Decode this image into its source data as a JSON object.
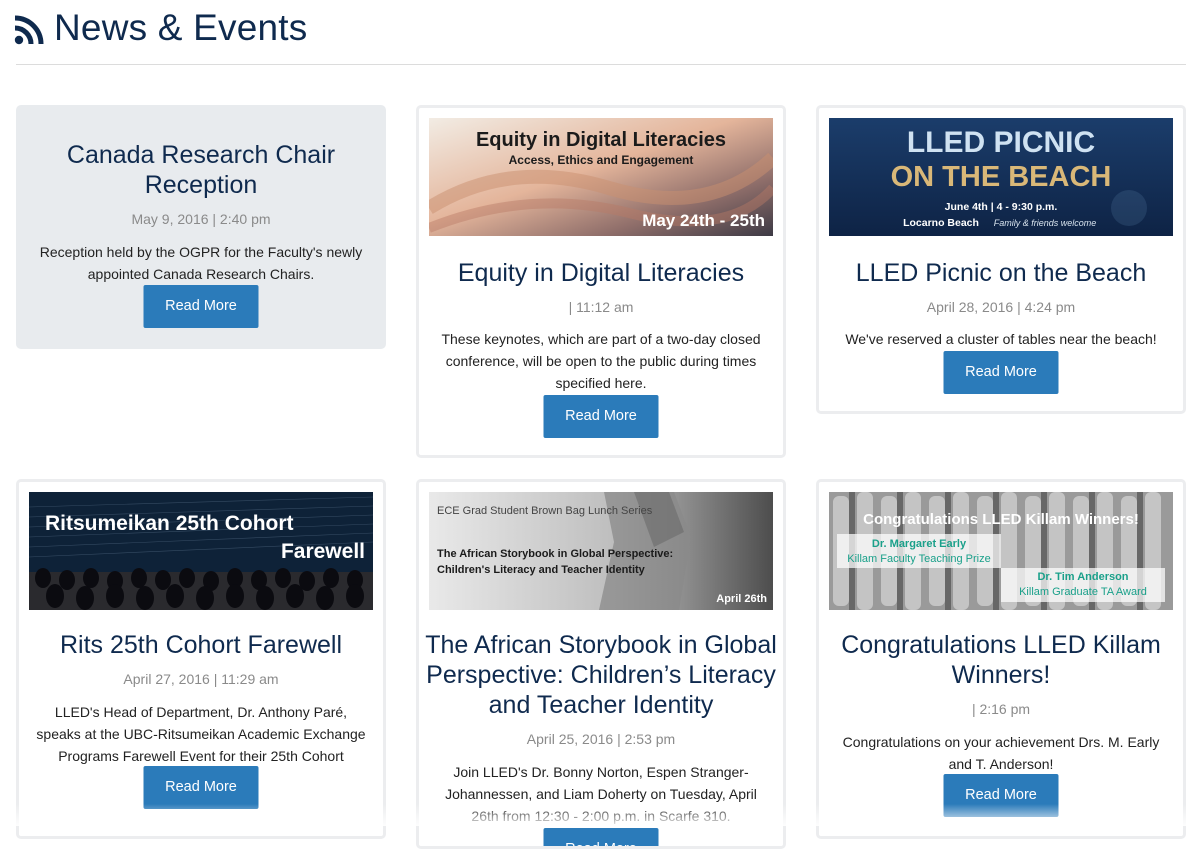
{
  "header": {
    "title": "News & Events",
    "icon": "rss-icon"
  },
  "cards": [
    {
      "title": "Canada Research Chair Reception",
      "date": "May 9, 2016 | 2:40 pm",
      "description": "Reception held by the OGPR for the Faculty's newly appointed Canada Research Chairs.",
      "button": "Read More"
    },
    {
      "image": {
        "heading": "Equity in Digital Literacies",
        "subheading": "Access, Ethics and Engagement",
        "dates": "May 24th - 25th"
      },
      "title": "Equity in Digital Literacies",
      "date": "| 11:12 am",
      "description": "These keynotes, which are part of a two-day closed conference, will be open to the public during times specified here.",
      "button": "Read More"
    },
    {
      "image": {
        "line1": "LLED PICNIC",
        "line2": "ON THE BEACH",
        "when": "June 4th  |  4 - 9:30 p.m.",
        "where": "Locarno Beach",
        "note": "Family & friends welcome"
      },
      "title": "LLED Picnic on the Beach",
      "date": "April 28, 2016 | 4:24 pm",
      "description": "We've reserved a cluster of tables near the beach!",
      "button": "Read More"
    },
    {
      "image": {
        "line1": "Ritsumeikan 25th Cohort",
        "line2": "Farewell"
      },
      "title": "Rits 25th Cohort Farewell",
      "date": "April 27, 2016 | 11:29 am",
      "description": "LLED's Head of Department, Dr. Anthony Paré, speaks at the UBC-Ritsumeikan Academic Exchange Programs Farewell Event for their 25th Cohort",
      "button": "Read More"
    },
    {
      "image": {
        "series": "ECE Grad Student Brown Bag Lunch Series",
        "line1": "The African Storybook in Global Perspective:",
        "line2": "Children's Literacy and Teacher Identity",
        "date": "April 26th"
      },
      "title": "The African Storybook in Global Perspective: Children’s Literacy and Teacher Identity",
      "date": "April 25, 2016 | 2:53 pm",
      "description": "Join LLED's Dr. Bonny Norton, Espen Stranger-Johannessen, and Liam Doherty on Tuesday, April 26th from 12:30 - 2:00 p.m. in Scarfe 310.",
      "button": "Read More"
    },
    {
      "image": {
        "heading": "Congratulations LLED Killam Winners!",
        "name1": "Dr. Margaret Early",
        "prize1": "Killam Faculty Teaching Prize",
        "name2": "Dr. Tim Anderson",
        "prize2": "Killam Graduate TA Award"
      },
      "title": "Congratulations LLED Killam Winners!",
      "date": "| 2:16 pm",
      "description": "Congratulations on your achievement Drs. M. Early and T. Anderson!",
      "button": "Read More"
    }
  ]
}
